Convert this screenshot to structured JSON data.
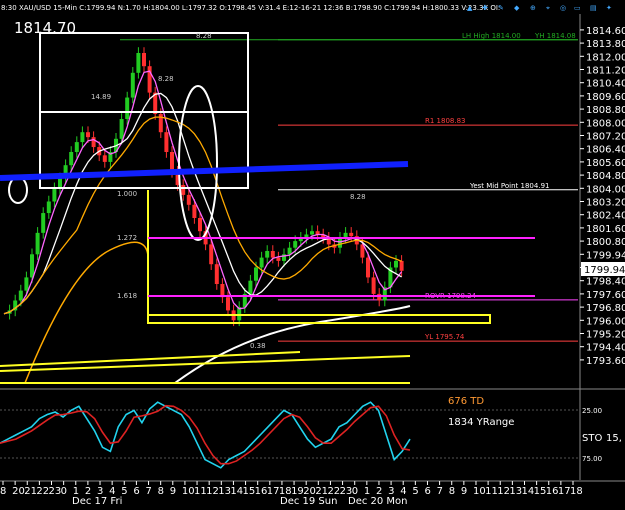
{
  "window": {
    "header_text": "8:30  XAU/USD  15-Min  C:1799.94  N:1.70  H:1804.00  L:1797.32  O:1798.45  V:31.4  E:12-16-21  12:36  B:1798.90  C:1799.94  H:1800.33  V:23.3K  OI:",
    "high_label": "1814.70"
  },
  "chart_data": {
    "type": "candlestick",
    "symbol": "XAU/USD",
    "timeframe": "15-Min",
    "ylim": [
      1793.2,
      1815.2
    ],
    "yticks": [
      "1814.00",
      "1813.00",
      "1812.00",
      "1811.00",
      "1810.00",
      "1809.00",
      "1808.00",
      "1807.00",
      "1806.00",
      "1805.00",
      "1804.00",
      "1803.00",
      "1802.00",
      "1801.00",
      "1800.00",
      "1799.00",
      "1798.00",
      "1797.00",
      "1796.00",
      "1795.00",
      "1794.00",
      "1793.00"
    ],
    "ytick_labels": [
      "1814.60",
      "1813.80",
      "1812.00",
      "1811.20",
      "1810.40",
      "1809.60",
      "1808.80",
      "1808.00",
      "1807.20",
      "1806.40",
      "1805.60",
      "1804.80",
      "1804.00",
      "1803.20",
      "1802.40",
      "1801.60",
      "1800.80",
      "1799.94",
      "1799.20",
      "1798.40",
      "1797.60",
      "1796.80",
      "1796.00",
      "1795.20",
      "1794.40",
      "1793.60"
    ],
    "ytick_values": [
      1814.6,
      1813.8,
      1813.0,
      1812.2,
      1811.4,
      1810.6,
      1809.8,
      1809.0,
      1808.2,
      1807.4,
      1806.6,
      1805.8,
      1805.0,
      1804.2,
      1803.4,
      1802.6,
      1801.8,
      1801.0,
      1800.2,
      1799.4,
      1798.6,
      1797.8,
      1797.0,
      1796.2,
      1795.4,
      1794.6
    ],
    "current_price": "1799.94",
    "levels": [
      {
        "label": "LH High 1814.00",
        "value": 1814.0,
        "color": "#22aa22"
      },
      {
        "label": "YH 1814.08",
        "value": 1814.0,
        "color": "#22aa22"
      },
      {
        "label": "R1 1808.83",
        "value": 1808.83,
        "color": "#ff4040"
      },
      {
        "label": "Yest Mid Point 1804.91",
        "value": 1804.91,
        "color": "#ffffff"
      },
      {
        "label": "ROVR 1798.24",
        "value": 1798.24,
        "color": "#ff44ff"
      },
      {
        "label": "YL 1795.74",
        "value": 1795.74,
        "color": "#ff4040"
      }
    ],
    "fib_labels": [
      "8.28",
      "14.89",
      "1.000",
      "1.272",
      "1.618",
      "8.28",
      "8.28",
      "0.38"
    ],
    "time_axis": [
      "8",
      "20",
      "21",
      "22",
      "23",
      "0",
      "1",
      "2",
      "3",
      "4",
      "5",
      "6",
      "7",
      "8",
      "9",
      "10",
      "11",
      "12",
      "13",
      "14",
      "15",
      "16",
      "17",
      "18",
      "19",
      "20",
      "21",
      "22",
      "23",
      "0",
      "1",
      "2",
      "3",
      "4",
      "5",
      "6",
      "7",
      "8",
      "9",
      "10",
      "11",
      "12",
      "13",
      "14",
      "15",
      "16",
      "17",
      "18"
    ],
    "date_labels": [
      "Dec 17 Fri",
      "Dec 19 Sun",
      "Dec 20 Mon"
    ],
    "indicator": {
      "name": "STO",
      "period": "15,",
      "levels": [
        "25.00",
        "75.00"
      ],
      "annotations": [
        "676 TD",
        "1834 YRange"
      ]
    },
    "colors": {
      "bull": "#22cc22",
      "bear": "#ff3030",
      "ma_blue": "#1020ff",
      "ma_white": "#ffffff",
      "ma_orange": "#ffaa00",
      "yellow": "#ffff22",
      "magenta": "#ff22ff"
    }
  }
}
